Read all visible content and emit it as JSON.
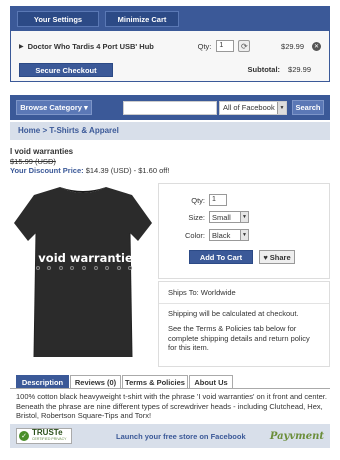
{
  "cart": {
    "settings_label": "Your Settings",
    "minimize_label": "Minimize Cart",
    "item_name": "Doctor Who Tardis 4 Port USB' Hub",
    "qty_label": "Qty:",
    "qty_value": "1",
    "item_price": "$29.99",
    "checkout_label": "Secure Checkout",
    "subtotal_label": "Subtotal:",
    "subtotal_value": "$29.99"
  },
  "browse": {
    "category_label": "Browse Category ▾",
    "scope_value": "All of Facebook",
    "search_label": "Search"
  },
  "breadcrumb": "Home > T-Shirts & Apparel",
  "product": {
    "title": "I void warranties",
    "old_price": "$15.99 (USD)",
    "discount_label": "Your Discount Price:",
    "discount_value": "$14.39 (USD) - $1.60 off!",
    "shirt_text": "i void warranties"
  },
  "options": {
    "qty_label": "Qty:",
    "qty_value": "1",
    "size_label": "Size:",
    "size_value": "Small",
    "color_label": "Color:",
    "color_value": "Black",
    "add_label": "Add To Cart",
    "share_label": "Share"
  },
  "info": {
    "ships": "Ships To: Worldwide",
    "shipping": "Shipping will be calculated at checkout.",
    "terms": "See the Terms & Policies tab below for complete shipping details and return policy for this item."
  },
  "tabs": [
    "Description",
    "Reviews (0)",
    "Terms & Policies",
    "About Us"
  ],
  "description": "100% cotton black heavyweight t-shirt with the phrase 'I void warranties' on it front and center. Beneath the phrase are nine different types of screwdriver heads - including Clutchead, Hex, Bristol, Robertson Square-Tips and Torx!",
  "footer": {
    "truste": "TRUSTe",
    "truste_sub": "CERTIFIED PRIVACY",
    "launch": "Launch your free store on Facebook",
    "payment": "Payvment"
  }
}
